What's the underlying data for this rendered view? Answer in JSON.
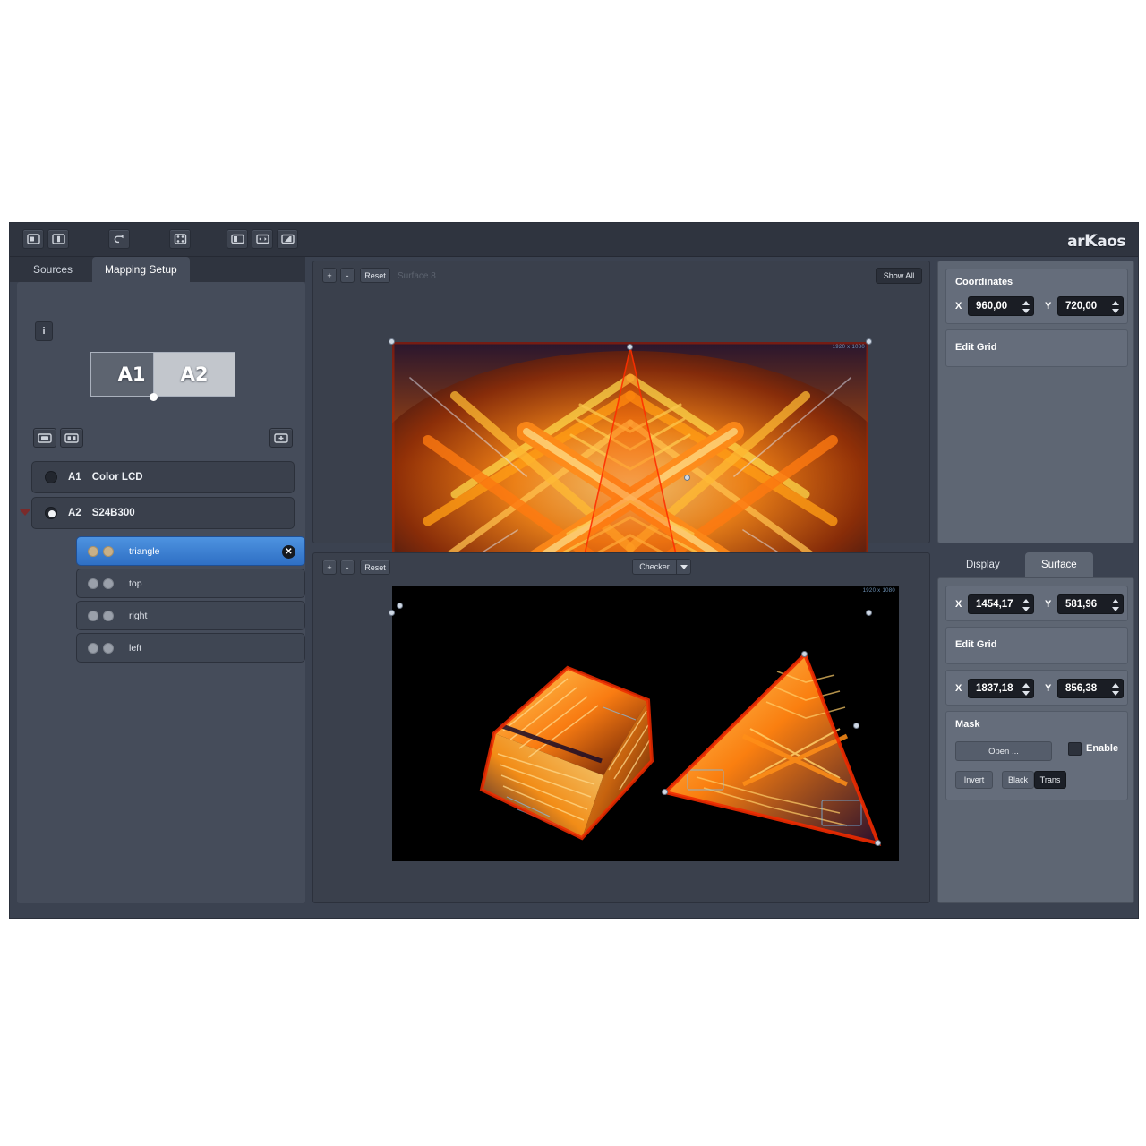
{
  "app": {
    "logo_prefix": "ar",
    "logo_k": "K",
    "logo_suffix": "aos"
  },
  "toolbar": {
    "icons": [
      {
        "name": "new-composition-icon",
        "label": "New"
      },
      {
        "name": "save-icon",
        "label": "Save"
      },
      {
        "name": "undo-icon",
        "label": "Undo"
      },
      {
        "name": "node-edit-icon",
        "label": "Edit Nodes"
      },
      {
        "name": "preview-display-icon",
        "label": "Preview"
      },
      {
        "name": "link-displays-icon",
        "label": "Link"
      },
      {
        "name": "fullscreen-icon",
        "label": "Fullscreen"
      }
    ]
  },
  "tabs": {
    "items": [
      {
        "label": "Sources",
        "active": false
      },
      {
        "label": "Mapping Setup",
        "active": true
      }
    ]
  },
  "sidebar": {
    "info_button": "i",
    "screens": [
      {
        "id": "A1",
        "label": "A1",
        "selected": false
      },
      {
        "id": "A2",
        "label": "A2",
        "selected": true
      }
    ],
    "list_tools": [
      {
        "name": "add-display-icon"
      },
      {
        "name": "remove-display-icon"
      },
      {
        "name": "add-surface-icon"
      }
    ],
    "displays": [
      {
        "slot": "A1",
        "name": "Color LCD",
        "selected": false,
        "expanded": false,
        "surfaces": []
      },
      {
        "slot": "A2",
        "name": "S24B300",
        "selected": true,
        "expanded": true,
        "surfaces": [
          {
            "label": "triangle",
            "selected": true,
            "closable": true
          },
          {
            "label": "top",
            "selected": false,
            "closable": false
          },
          {
            "label": "right",
            "selected": false,
            "closable": false
          },
          {
            "label": "left",
            "selected": false,
            "closable": false
          }
        ]
      }
    ]
  },
  "viewport_top": {
    "zoom_in": "+",
    "zoom_out": "-",
    "reset": "Reset",
    "surface_label": "Surface 8",
    "show_all": "Show All",
    "resolution_tag": "1920 x 1080"
  },
  "viewport_bottom": {
    "zoom_in": "+",
    "zoom_out": "-",
    "reset": "Reset",
    "background_mode": "Checker",
    "resolution_tag": "1920 x 1080"
  },
  "panel_coordinates": {
    "title": "Coordinates",
    "x_label": "X",
    "x_value": "960,00",
    "y_label": "Y",
    "y_value": "720,00",
    "edit_grid": "Edit Grid"
  },
  "panel_surface": {
    "tabs": [
      {
        "label": "Display",
        "active": false
      },
      {
        "label": "Surface",
        "active": true
      }
    ],
    "point_a": {
      "x_label": "X",
      "x_value": "1454,17",
      "y_label": "Y",
      "y_value": "581,96"
    },
    "edit_grid": "Edit Grid",
    "point_b": {
      "x_label": "X",
      "x_value": "1837,18",
      "y_label": "Y",
      "y_value": "856,38"
    },
    "mask": {
      "title": "Mask",
      "open_button": "Open ...",
      "enable_label": "Enable",
      "enable_checked": false,
      "modes": [
        {
          "label": "Invert",
          "active": false
        },
        {
          "label": "Black",
          "active": false
        },
        {
          "label": "Trans",
          "active": true
        }
      ]
    }
  },
  "colors": {
    "window_bg": "#3b4250",
    "toolbar_bg": "#2f343f",
    "panel_bg": "#454c5a",
    "right_panel_bg": "#5e6673",
    "selection_blue": "#3f7fd0",
    "field_bg": "#1a1d24",
    "text": "#ffffff"
  }
}
